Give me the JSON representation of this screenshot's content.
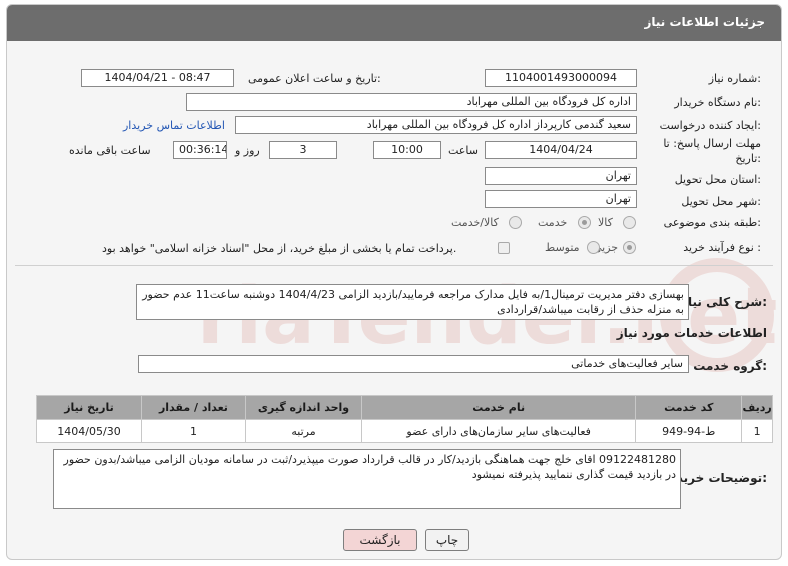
{
  "header": {
    "title": "جزئیات اطلاعات نیاز"
  },
  "fields": {
    "need_number_label": "شماره نیاز:",
    "need_number": "1104001493000094",
    "announce_label": "تاریخ و ساعت اعلان عمومی:",
    "announce_value": "1404/04/21 - 08:47",
    "buyer_org_label": "نام دستگاه خریدار:",
    "buyer_org": "اداره کل فرودگاه بین المللی مهراباد",
    "creator_label": "ایجاد کننده درخواست:",
    "creator": "سعید گندمی کارپرداز اداره کل فرودگاه بین المللی مهراباد",
    "contact_link": "اطلاعات تماس خریدار",
    "deadline_label_1": "مهلت ارسال پاسخ: تا",
    "deadline_label_2": "تاریخ:",
    "deadline_date": "1404/04/24",
    "time_label": "ساعت",
    "deadline_time": "10:00",
    "days_value": "3",
    "days_label": "روز و",
    "remaining_time": "00:36:14",
    "remaining_label": "ساعت باقی مانده",
    "province_label": "استان محل تحویل:",
    "province": "تهران",
    "city_label": "شهر محل تحویل:",
    "city": "تهران",
    "category_label": "طبقه بندی موضوعی:",
    "category_options": [
      "کالا",
      "خدمت",
      "کالا/خدمت"
    ],
    "category_selected": "خدمت",
    "process_label": "نوع فرآیند خرید :",
    "process_options": [
      "جزیی",
      "متوسط"
    ],
    "process_selected": "جزیی",
    "payment_note": "پرداخت تمام یا بخشی از مبلغ خرید، از محل \"اسناد خزانه اسلامی\" خواهد بود."
  },
  "description": {
    "label": "شرح کلی نیاز:",
    "text": "بهسازی دفتر مدیریت ترمینال1/به فایل مدارک مراجعه فرمایید/بازدید الزامی 1404/4/23 دوشنبه ساعت11 عدم حضور به منزله حذف از رقابت میباشد/قراردادی"
  },
  "services": {
    "section_title": "اطلاعات خدمات مورد نیاز",
    "group_label": "گروه خدمت:",
    "group_value": "سایر فعالیت‌های خدماتی",
    "columns": [
      "ردیف",
      "کد خدمت",
      "نام خدمت",
      "واحد اندازه گیری",
      "تعداد / مقدار",
      "تاریخ نیاز"
    ],
    "rows": [
      [
        "1",
        "ط-94-949",
        "فعالیت‌های سایر سازمان‌های دارای عضو",
        "مرتبه",
        "1",
        "1404/05/30"
      ]
    ]
  },
  "buyer_notes": {
    "label": "توضیحات خریدار:",
    "text": "09122481280 اقای خلج جهت هماهنگی بازدید/کار در قالب قرارداد صورت میپذیرد/ثبت در سامانه مودیان الزامی میباشد/بدون حضور در بازدید قیمت گذاری ننمایید پذیرفته نمیشود"
  },
  "buttons": {
    "print": "چاپ",
    "back": "بازگشت"
  },
  "watermark": "AriaTender.net",
  "colors": {
    "header": "#6d6d6d",
    "link": "#2457b4",
    "back_button": "#f3d5d5",
    "table_header": "#a6a6a6"
  }
}
